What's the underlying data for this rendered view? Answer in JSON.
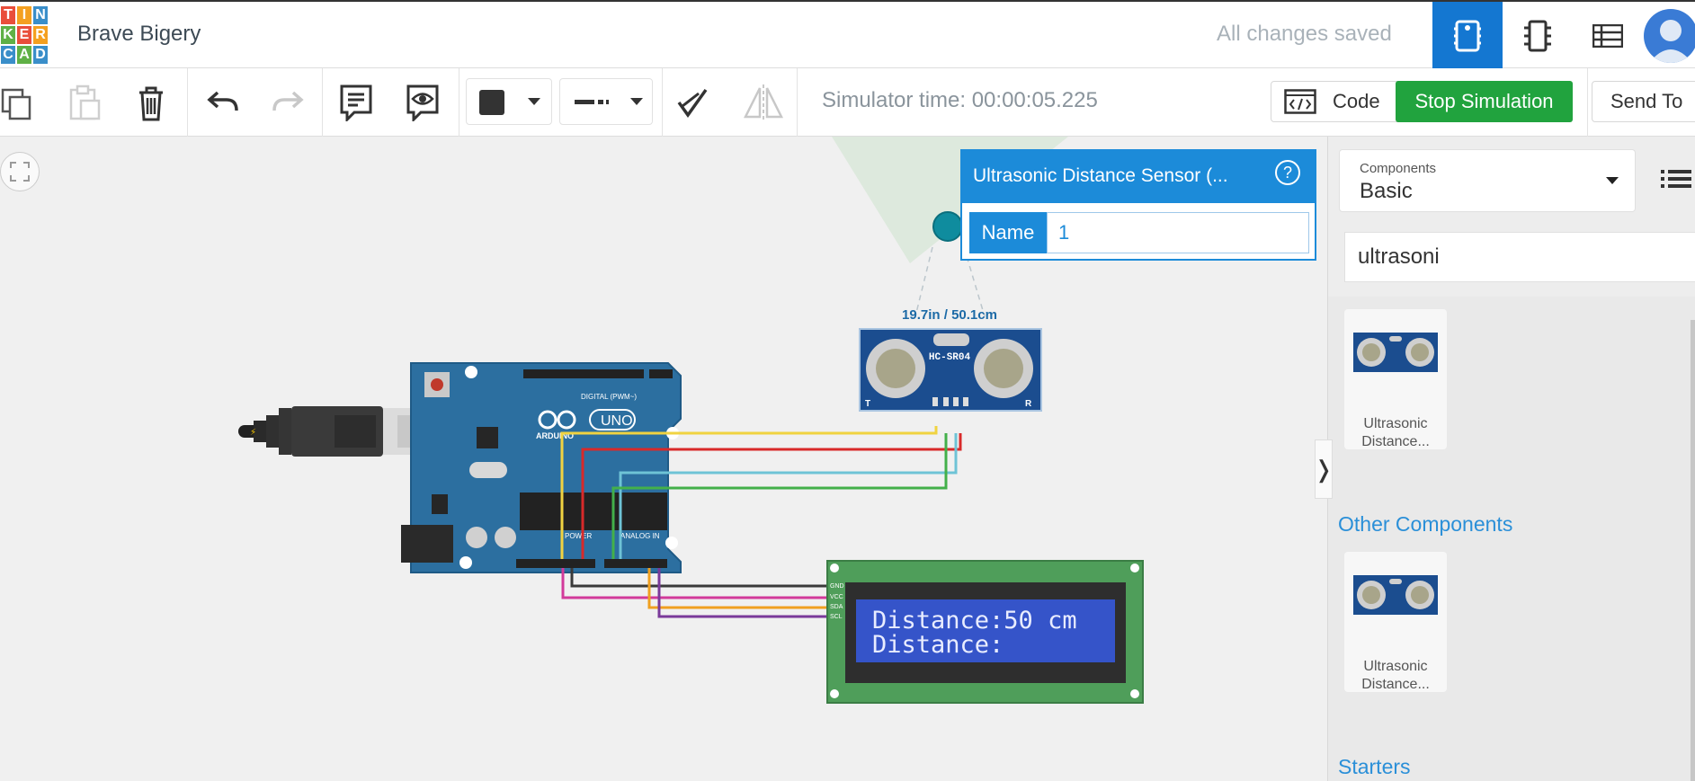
{
  "app": {
    "logo_letters": [
      "T",
      "I",
      "N",
      "K",
      "E",
      "R",
      "C",
      "A",
      "D"
    ],
    "project_title": "Brave Bigery",
    "save_status": "All changes saved"
  },
  "topbar": {
    "views": [
      {
        "name": "circuit-view",
        "icon": "breadboard-icon",
        "active": true
      },
      {
        "name": "schematic-view",
        "icon": "chip-icon",
        "active": false
      },
      {
        "name": "component-list-view",
        "icon": "table-icon",
        "active": false
      }
    ]
  },
  "toolbar": {
    "tools": [
      "copy-icon",
      "paste-icon",
      "delete-icon",
      "undo-icon",
      "redo-icon",
      "note-icon",
      "notes-visibility-icon",
      "fill-color-icon",
      "line-style-icon",
      "annotate-icon",
      "flip-icon"
    ],
    "simulator_time": "Simulator time: 00:00:05.225",
    "code_label": "Code",
    "stop_label": "Stop Simulation",
    "send_label": "Send To"
  },
  "canvas": {
    "distance_readout": "19.7in / 50.1cm",
    "sensor_model": "HC-SR04",
    "sensor_pin_left": "T",
    "sensor_pin_right": "R",
    "board_label": "UNO",
    "board_brand": "ARDUINO",
    "board_digital": "DIGITAL (PWM~)",
    "board_power": "POWER",
    "board_analog": "ANALOG IN",
    "lcd_line1": "Distance:50 cm",
    "lcd_line2": "Distance:",
    "lcd_pins": [
      "GND",
      "VCC",
      "SDA",
      "SCL"
    ]
  },
  "inspector": {
    "title": "Ultrasonic Distance Sensor (...",
    "help": "?",
    "name_label": "Name",
    "name_value": "1"
  },
  "panel": {
    "components_label": "Components",
    "components_value": "Basic",
    "search_value": "ultrasoni",
    "results": [
      {
        "label": "Ultrasonic Distance..."
      }
    ],
    "other_heading": "Other Components",
    "other_results": [
      {
        "label": "Ultrasonic Distance..."
      }
    ],
    "starters_heading": "Starters",
    "collapse_glyph": "❭"
  },
  "colors": {
    "accent": "#1c8bd9",
    "stop": "#21a33e",
    "logo": [
      "#e94e3b",
      "#f4a020",
      "#3a8ec9",
      "#5fb046",
      "#e94e3b",
      "#f4a020",
      "#3a8ec9",
      "#5fb046",
      "#3a8ec9"
    ]
  }
}
